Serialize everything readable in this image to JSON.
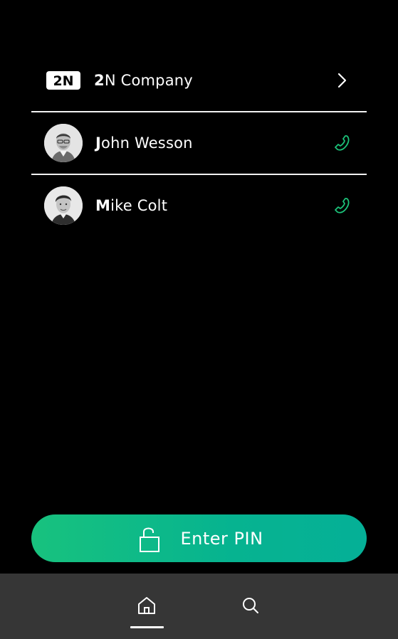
{
  "contacts": [
    {
      "type": "company",
      "name_first": "2",
      "name_rest": "N Company",
      "logo_text": "2N",
      "action_icon": "chevron-right-icon"
    },
    {
      "type": "person",
      "name_first": "J",
      "name_rest": "ohn Wesson",
      "action_icon": "phone-icon"
    },
    {
      "type": "person",
      "name_first": "M",
      "name_rest": "ike Colt",
      "action_icon": "phone-icon"
    }
  ],
  "pin_button": {
    "label": "Enter PIN",
    "icon": "unlock-icon"
  },
  "bottom_nav": {
    "items": [
      {
        "icon": "home-icon",
        "active": true
      },
      {
        "icon": "search-icon",
        "active": false
      }
    ]
  },
  "colors": {
    "accent_green": "#1cc37a",
    "button_gradient_start": "#18c27e",
    "button_gradient_end": "#05b097",
    "bottom_bar": "#363636",
    "background": "#000000"
  }
}
